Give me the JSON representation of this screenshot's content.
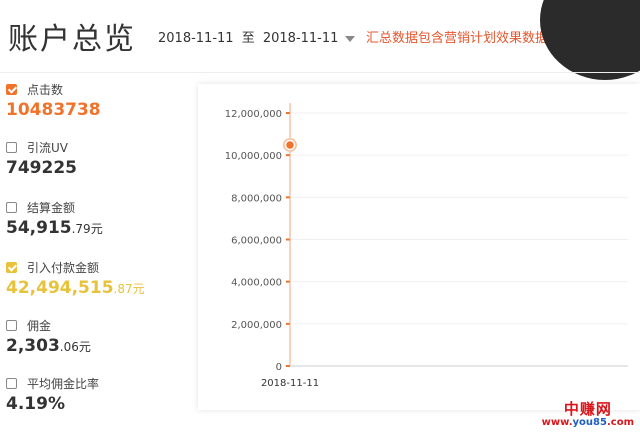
{
  "header": {
    "title": "账户总览",
    "date_start": "2018-11-11",
    "date_sep": "至",
    "date_end": "2018-11-11",
    "notice": "汇总数据包含营销计划效果数据"
  },
  "metrics": [
    {
      "label": "点击数",
      "value": "10483738",
      "decimal": "",
      "checked": true,
      "color": "#f0732b"
    },
    {
      "label": "引流UV",
      "value": "749225",
      "decimal": "",
      "checked": false
    },
    {
      "label": "结算金额",
      "value": "54,915",
      "decimal": ".79元",
      "checked": false
    },
    {
      "label": "引入付款金额",
      "value": "42,494,515",
      "decimal": ".87元",
      "checked": true,
      "color": "#e8c23a"
    },
    {
      "label": "佣金",
      "value": "2,303",
      "decimal": ".06元",
      "checked": false
    },
    {
      "label": "平均佣金比率",
      "value": "4.19%",
      "decimal": "",
      "checked": false
    }
  ],
  "chart_data": {
    "type": "line",
    "categories": [
      "2018-11-11"
    ],
    "series": [
      {
        "values": [
          10483738
        ],
        "color": "#f0732b"
      }
    ],
    "yticks": [
      "12,000,000",
      "10,000,000",
      "8,000,000",
      "6,000,000",
      "4,000,000",
      "2,000,000",
      "0"
    ],
    "ylim": [
      0,
      12000000
    ],
    "grid": true
  },
  "watermark": {
    "cn": "中赚网",
    "url_prefix": "www.",
    "url_brand": "you85",
    "url_suffix": ".com"
  }
}
